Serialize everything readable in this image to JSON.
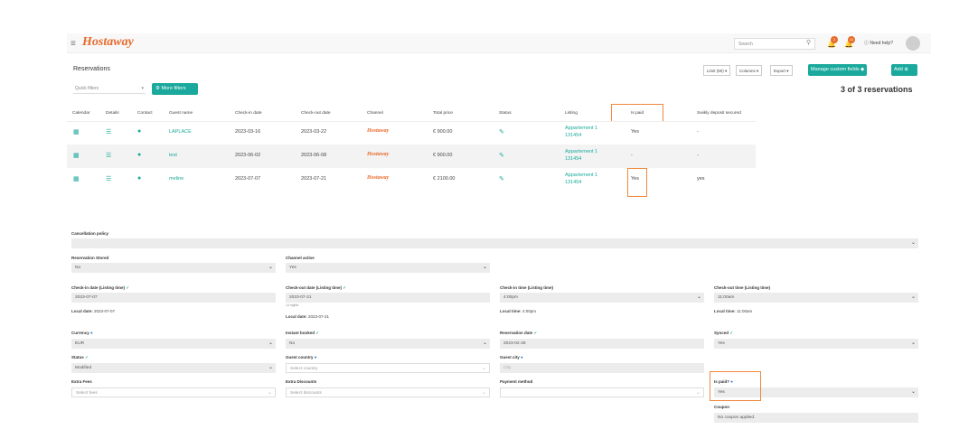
{
  "header": {
    "logo": "Hostaway",
    "search_placeholder": "Search",
    "bell1_badge": "2",
    "bell2_badge": "11",
    "help_label": "Need help?"
  },
  "page": {
    "title": "Reservations",
    "limit_label": "Limit (50) ▾",
    "columns_label": "Columns ▾",
    "export_label": "Export ▾",
    "manage_fields_label": "Manage custom fields",
    "add_label": "Add",
    "count_label": "3 of 3 reservations",
    "quick_filters": "Quick filters",
    "more_filters": "More filters"
  },
  "table": {
    "headers": [
      "Calendar",
      "Details",
      "Contact",
      "Guest name",
      "Check-in date",
      "Check-out date",
      "Channel",
      "Total price",
      "Status",
      "Listing",
      "Is paid",
      "Swikly deposit secured"
    ],
    "rows": [
      {
        "guest": "LAPLACE",
        "checkin": "2023-03-16",
        "checkout": "2023-03-22",
        "channel": "Hostaway",
        "price": "€ 900.00",
        "listing1": "Appartement 1",
        "listing2": "131454",
        "paid": "Yes",
        "swikly": "-"
      },
      {
        "guest": "test",
        "checkin": "2023-06-02",
        "checkout": "2023-06-08",
        "channel": "Hostaway",
        "price": "€ 900.00",
        "listing1": "Appartement 1",
        "listing2": "131454",
        "paid": "-",
        "swikly": "-"
      },
      {
        "guest": "meline",
        "checkin": "2023-07-07",
        "checkout": "2023-07-21",
        "channel": "Hostaway",
        "price": "€ 2100.00",
        "listing1": "Appartement 1",
        "listing2": "131454",
        "paid": "Yes",
        "swikly": "yes"
      }
    ]
  },
  "form": {
    "cancellation_label": "Cancellation policy",
    "cancellation_value": "",
    "reservation_stored_label": "Reservation Stored",
    "reservation_stored_value": "No",
    "channel_active_label": "Channel active",
    "channel_active_value": "Yes",
    "checkin_date_label": "Check-in date (Listing time)",
    "checkin_date_value": "2023-07-07",
    "checkin_local_label": "Local date:",
    "checkin_local_value": "2023-07-07",
    "checkout_date_label": "Check-out date (Listing time)",
    "checkout_date_value": "2023-07-21",
    "nights": "14 nights",
    "checkout_local_label": "Local date:",
    "checkout_local_value": "2023-07-21",
    "checkin_time_label": "Check-in time (Listing time)",
    "checkin_time_value": "4:00pm",
    "checkin_local_time_label": "Local time:",
    "checkin_local_time_value": "4:00pm",
    "checkout_time_label": "Check-out time (Listing time)",
    "checkout_time_value": "11:00am",
    "checkout_local_time_label": "Local time:",
    "checkout_local_time_value": "11:00am",
    "currency_label": "Currency",
    "currency_value": "EUR",
    "instant_booked_label": "Instant booked",
    "instant_booked_value": "No",
    "reservation_date_label": "Reservation date",
    "reservation_date_value": "2023-02-28",
    "synced_label": "Synced",
    "synced_value": "Yes",
    "status_label": "Status",
    "status_value": "Modified",
    "guest_country_label": "Guest country",
    "guest_country_placeholder": "Select country",
    "guest_city_label": "Guest city",
    "guest_city_placeholder": "City",
    "extra_fees_label": "Extra Fees",
    "extra_fees_placeholder": "Select fees",
    "extra_discounts_label": "Extra Discounts",
    "extra_discounts_placeholder": "Select discounts",
    "payment_method_label": "Payment method",
    "payment_method_value": "",
    "is_paid_label": "Is paid?",
    "is_paid_value": "Yes",
    "coupon_label": "Coupon",
    "coupon_value": "No coupon applied."
  },
  "colors": {
    "accent": "#1aa99c",
    "brand": "#e86a2a",
    "highlight": "#f0883e"
  }
}
